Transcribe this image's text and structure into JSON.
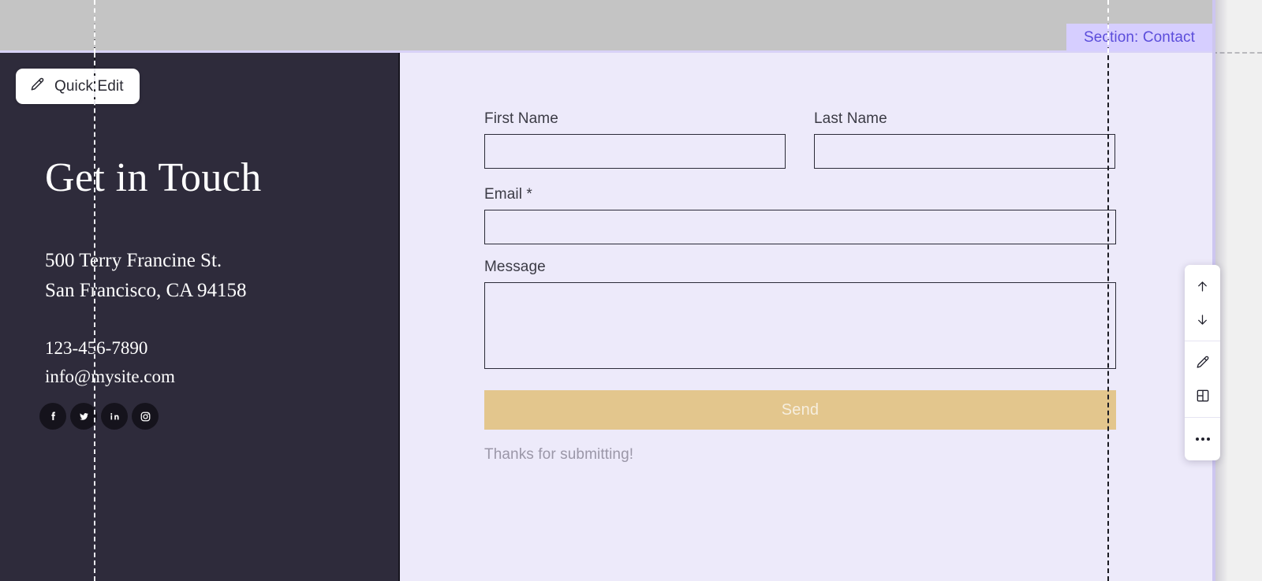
{
  "editor": {
    "section_label": "Section: Contact",
    "quick_edit_label": "Quick Edit",
    "quick_edit_icon": "pencil-icon",
    "toolbar": {
      "move_up_icon": "arrow-up-icon",
      "move_down_icon": "arrow-down-icon",
      "edit_icon": "pencil-icon",
      "layout_icon": "layout-panel-icon",
      "more_icon": "more-options-icon"
    },
    "colors": {
      "section_label_bg": "#d6ceff",
      "section_label_text": "#5b4ddb",
      "canvas_top_bar": "#c4c4c4",
      "editor_background": "#f0f0f0",
      "guide_line": "#1a1a22"
    }
  },
  "contact": {
    "heading": "Get in Touch",
    "address_line_1": "500 Terry Francine St.",
    "address_line_2": "San Francisco, CA 94158",
    "phone": "123-456-7890",
    "email": "info@mysite.com",
    "socials": [
      {
        "name": "facebook-icon",
        "label": "Facebook"
      },
      {
        "name": "twitter-icon",
        "label": "Twitter"
      },
      {
        "name": "linkedin-icon",
        "label": "LinkedIn"
      },
      {
        "name": "instagram-icon",
        "label": "Instagram"
      }
    ],
    "colors": {
      "panel_background": "#2e2b3b",
      "form_background": "#edeafa",
      "send_button": "#e3c68d",
      "heading_text": "#ffffff"
    }
  },
  "form": {
    "fields": {
      "first_name": {
        "label": "First Name",
        "value": "",
        "placeholder": ""
      },
      "last_name": {
        "label": "Last Name",
        "value": "",
        "placeholder": ""
      },
      "email": {
        "label": "Email *",
        "value": "",
        "placeholder": ""
      },
      "message": {
        "label": "Message",
        "value": "",
        "placeholder": ""
      }
    },
    "submit_label": "Send",
    "success_message": "Thanks for submitting!"
  }
}
